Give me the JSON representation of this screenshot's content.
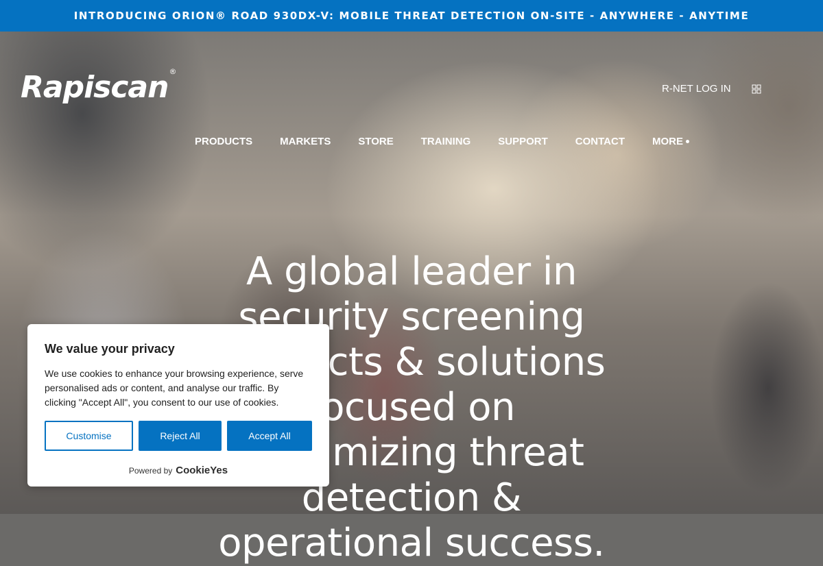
{
  "announcement": {
    "text": "INTRODUCING ORION® ROAD 930DX-V: MOBILE THREAT DETECTION ON-SITE - ANYWHERE - ANYTIME"
  },
  "header": {
    "logo_text": "Rapiscan",
    "logo_mark": "®",
    "rnet_label": "R-NET LOG IN",
    "apps_icon": "grid-icon"
  },
  "nav": {
    "items": [
      {
        "label": "PRODUCTS"
      },
      {
        "label": "MARKETS"
      },
      {
        "label": "STORE"
      },
      {
        "label": "TRAINING"
      },
      {
        "label": "SUPPORT"
      },
      {
        "label": "CONTACT"
      },
      {
        "label": "MORE"
      }
    ]
  },
  "hero": {
    "headline": "A global leader in security screening products & solutions focused on maximizing threat detection & operational success."
  },
  "cookie": {
    "title": "We value your privacy",
    "body": "We use cookies to enhance your browsing experience, serve personalised ads or content, and analyse our traffic. By clicking \"Accept All\", you consent to our use of cookies.",
    "customise_label": "Customise",
    "reject_label": "Reject All",
    "accept_label": "Accept All",
    "powered_by": "Powered by",
    "powered_brand": "CookieYes"
  },
  "colors": {
    "brand_blue": "#0572c1",
    "text_dark": "#212121"
  }
}
